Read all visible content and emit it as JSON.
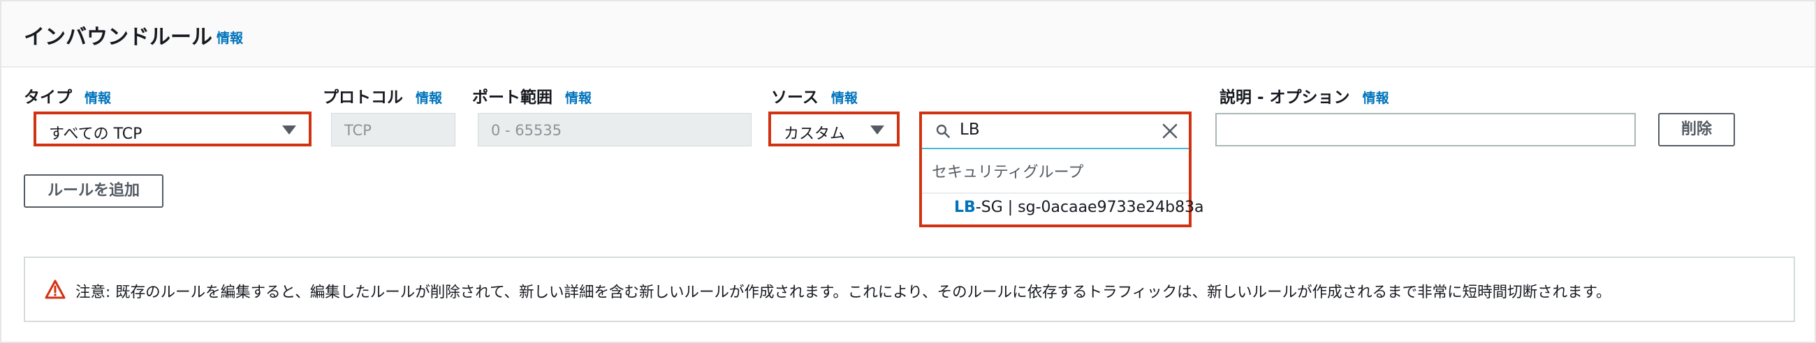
{
  "panel": {
    "title": "インバウンドルール",
    "info": "情報"
  },
  "fields": {
    "type": {
      "label": "タイプ",
      "info": "情報",
      "value": "すべての TCP"
    },
    "protocol": {
      "label": "プロトコル",
      "info": "情報",
      "value": "TCP"
    },
    "port_range": {
      "label": "ポート範囲",
      "info": "情報",
      "value": "0 - 65535"
    },
    "source": {
      "label": "ソース",
      "info": "情報",
      "value": "カスタム"
    },
    "description": {
      "label": "説明 - オプション",
      "info": "情報",
      "value": ""
    }
  },
  "search": {
    "value": "LB",
    "group_label": "セキュリティグループ",
    "option_match": "LB",
    "option_rest": "-SG | sg-0acaae9733e24b83a"
  },
  "buttons": {
    "delete": "削除",
    "add_rule": "ルールを追加"
  },
  "alert": {
    "text": "注意: 既存のルールを編集すると、編集したルールが削除されて、新しい詳細を含む新しいルールが作成されます。これにより、そのルールに依存するトラフィックは、新しいルールが作成されるまで非常に短時間切断されます。"
  },
  "colors": {
    "highlight_border": "#d13212",
    "link": "#0073bb",
    "warning": "#d13212"
  },
  "icons": {
    "search": "search-icon",
    "clear": "close-icon",
    "caret": "caret-down-icon",
    "alert": "warning-icon"
  }
}
